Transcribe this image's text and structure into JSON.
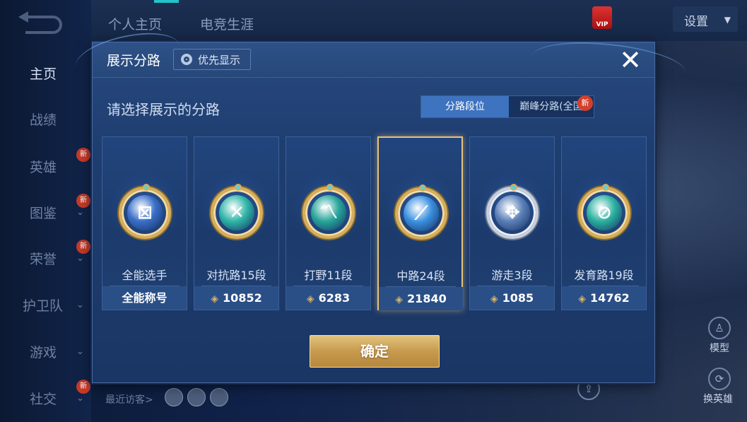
{
  "top_nav": {
    "tabs": [
      "个人主页",
      "电竞生涯"
    ],
    "settings_label": "设置",
    "vip_text": "VIP"
  },
  "left_nav": {
    "items": [
      {
        "label": "主页",
        "active": true,
        "new": false,
        "chevron": false
      },
      {
        "label": "战绩",
        "active": false,
        "new": false,
        "chevron": false
      },
      {
        "label": "英雄",
        "active": false,
        "new": true,
        "chevron": false
      },
      {
        "label": "图鉴",
        "active": false,
        "new": true,
        "chevron": true
      },
      {
        "label": "荣誉",
        "active": false,
        "new": true,
        "chevron": true
      },
      {
        "label": "护卫队",
        "active": false,
        "new": false,
        "chevron": true
      },
      {
        "label": "游戏",
        "active": false,
        "new": false,
        "chevron": true
      },
      {
        "label": "社交",
        "active": false,
        "new": true,
        "chevron": true
      }
    ],
    "new_label": "新"
  },
  "recent_visitors_label": "最近访客>",
  "right_side": {
    "model_label": "模型",
    "switch_hero_label": "换英雄"
  },
  "dialog": {
    "title": "展示分路",
    "priority_label": "优先显示",
    "close_glyph": "✕",
    "subtitle": "请选择展示的分路",
    "segment_tabs": [
      {
        "label": "分路段位",
        "active": true
      },
      {
        "label": "巅峰分路(全国",
        "active": false
      }
    ],
    "segment_new_label": "新",
    "confirm_label": "确定",
    "points_icon": "◈",
    "lanes": [
      {
        "name": "全能选手",
        "foot": "全能称号",
        "has_points": false,
        "selected": false,
        "badge_color": "#3a6fc9",
        "glyph": "⊠",
        "silver": false
      },
      {
        "name": "对抗路15段",
        "foot": "10852",
        "has_points": true,
        "selected": false,
        "badge_color": "#2fb5a8",
        "glyph": "✕",
        "silver": false
      },
      {
        "name": "打野11段",
        "foot": "6283",
        "has_points": true,
        "selected": false,
        "badge_color": "#27a59a",
        "glyph": "〽",
        "silver": false
      },
      {
        "name": "中路24段",
        "foot": "21840",
        "has_points": true,
        "selected": true,
        "badge_color": "#3a8fe0",
        "glyph": "⟋",
        "silver": false
      },
      {
        "name": "游走3段",
        "foot": "1085",
        "has_points": true,
        "selected": false,
        "badge_color": "#5b7fb8",
        "glyph": "✥",
        "silver": true
      },
      {
        "name": "发育路19段",
        "foot": "14762",
        "has_points": true,
        "selected": false,
        "badge_color": "#2bb19f",
        "glyph": "⊘",
        "silver": false
      }
    ]
  }
}
